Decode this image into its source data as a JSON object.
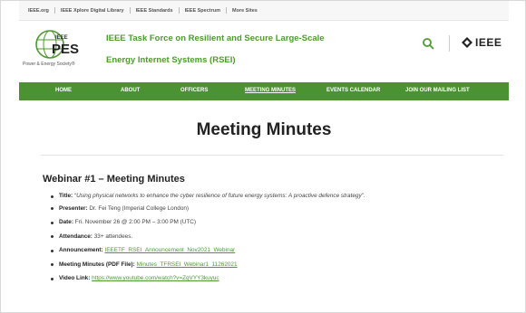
{
  "topbar": {
    "links": [
      "IEEE.org",
      "IEEE Xplore Digital Library",
      "IEEE Standards",
      "IEEE Spectrum",
      "More Sites"
    ]
  },
  "header": {
    "logo_caption": "Power & Energy Society®",
    "logo_text": "PES",
    "logo_small": "IEEE",
    "title_line1": "IEEE Task Force on Resilient and Secure Large-Scale",
    "title_line2": "Energy Internet Systems (RSEI)",
    "ieee_logo_text": "IEEE",
    "search_icon": "search-icon",
    "brand_color": "#4e9a2f"
  },
  "nav": {
    "items": [
      "HOME",
      "ABOUT",
      "OFFICERS",
      "MEETING MINUTES",
      "EVENTS CALENDAR",
      "JOIN OUR MAILING LIST"
    ],
    "active": "MEETING MINUTES",
    "bg_color": "#4b9332"
  },
  "page": {
    "title": "Meeting Minutes",
    "section_heading": "Webinar #1 – Meeting Minutes",
    "items": {
      "title_label": "Title:",
      "title_value": "“Using physical networks to enhance the cyber resilience of future energy systems: A proactive defence strategy”.",
      "presenter_label": "Presenter:",
      "presenter_value": "Dr. Fei Teng (Imperial College London)",
      "date_label": "Date:",
      "date_value": "Fri. November 26 @ 2:00 PM – 3:00 PM (UTC)",
      "attendance_label": "Attendance:",
      "attendance_value": "33+ attendees.",
      "announcement_label": "Announcement:",
      "announcement_value": "IEEETF_RSEI_Announcement_Nov2021_Webinar",
      "minutes_label": "Meeting Minutes (PDF File):",
      "minutes_value": "Minutes_TFRSEI_Webinar1_11262021",
      "video_label": "Video Link:",
      "video_value": "https://www.youtube.com/watch?v=ZqVYY3kuyuc"
    }
  }
}
